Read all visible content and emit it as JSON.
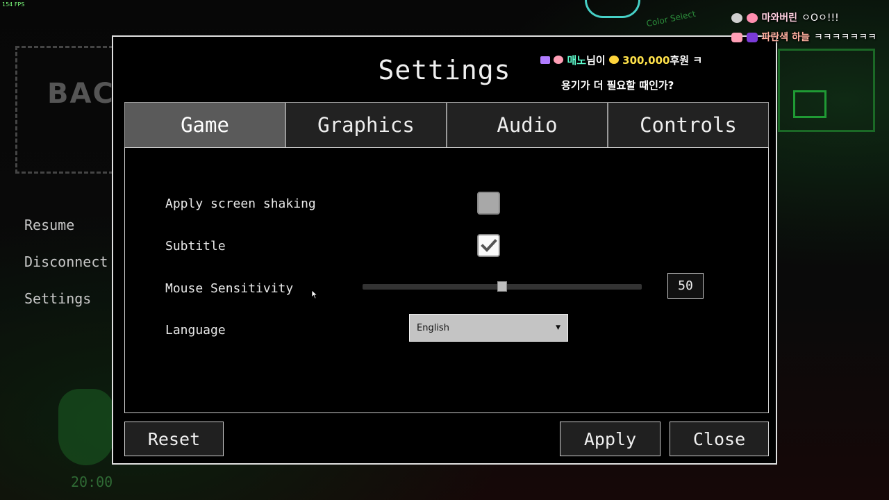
{
  "overlay": {
    "fps": "154 FPS"
  },
  "background": {
    "logo_text": "BAC",
    "tag_text": "Color Select",
    "menu": [
      "Resume",
      "Disconnect",
      "Settings"
    ],
    "time": "20:00"
  },
  "chat": {
    "messages": [
      {
        "user": "마와버린",
        "text": "ㅇOㅇ!!!"
      },
      {
        "user": "파란색 하늘",
        "text": "ㅋㅋㅋㅋㅋㅋㅋ"
      }
    ],
    "donation": {
      "name": "매노",
      "suffix": "님이",
      "amount": "300,000",
      "unit": "후원",
      "tail": "ㅋ",
      "message": "용기가 더 필요할 때인가?"
    }
  },
  "settings": {
    "title": "Settings",
    "tabs": [
      {
        "label": "Game",
        "active": true
      },
      {
        "label": "Graphics",
        "active": false
      },
      {
        "label": "Audio",
        "active": false
      },
      {
        "label": "Controls",
        "active": false
      }
    ],
    "options": {
      "screen_shaking": {
        "label": "Apply screen shaking",
        "checked": false
      },
      "subtitle": {
        "label": "Subtitle",
        "checked": true
      },
      "mouse_sensitivity": {
        "label": "Mouse Sensitivity",
        "value": "50",
        "fraction": 0.5
      },
      "language": {
        "label": "Language",
        "value": "English"
      }
    },
    "buttons": {
      "reset": "Reset",
      "apply": "Apply",
      "close": "Close"
    }
  }
}
